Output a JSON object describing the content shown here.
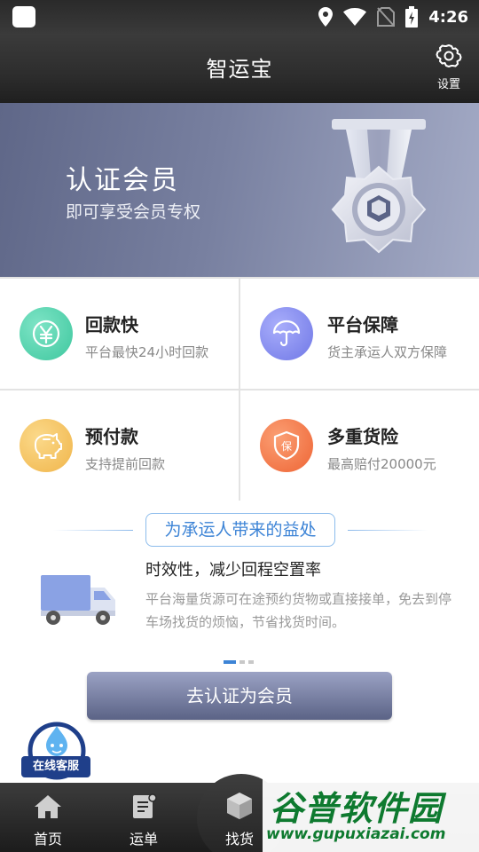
{
  "status_bar": {
    "time": "4:26",
    "icons": [
      "notification-square-icon",
      "location-icon",
      "wifi-icon",
      "no-sim-icon",
      "battery-charging-icon"
    ]
  },
  "header": {
    "title": "智运宝",
    "settings_label": "设置"
  },
  "banner": {
    "title": "认证会员",
    "subtitle": "即可享受会员专权"
  },
  "benefits_grid": [
    {
      "title": "回款快",
      "desc": "平台最快24小时回款",
      "icon": "yen-icon",
      "color": "#4ccfa9"
    },
    {
      "title": "平台保障",
      "desc": "货主承运人双方保障",
      "icon": "umbrella-icon",
      "color": "#7f86ee"
    },
    {
      "title": "预付款",
      "desc": "支持提前回款",
      "icon": "piggy-bank-icon",
      "color": "#f3c260"
    },
    {
      "title": "多重货险",
      "desc": "最高赔付20000元",
      "icon": "insurance-icon",
      "color": "#f37b4a"
    }
  ],
  "section": {
    "tag": "为承运人带来的益处",
    "headline": "时效性，减少回程空置率",
    "text": "平台海量货源可在途预约货物或直接接单，免去到停车场找货的烦恼，节省找货时间。",
    "carousel_page": 1,
    "carousel_pages": 3
  },
  "cta": {
    "label": "去认证为会员"
  },
  "customer_service": {
    "label": "在线客服"
  },
  "bottom_nav": [
    {
      "label": "首页",
      "icon": "home-icon"
    },
    {
      "label": "运单",
      "icon": "waybill-icon"
    },
    {
      "label": "找货",
      "icon": "cube-icon"
    }
  ],
  "watermark": {
    "brand": "谷普软件园",
    "url": "www.gupuxiazai.com"
  }
}
